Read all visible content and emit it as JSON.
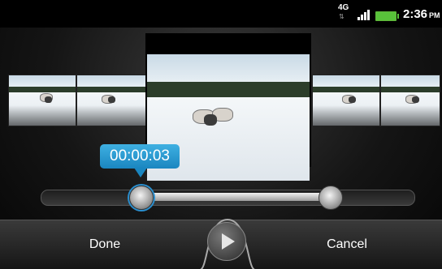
{
  "status_bar": {
    "network": "4G",
    "time": "2:36",
    "ampm": "PM",
    "battery_color": "#58c23a"
  },
  "trimmer": {
    "current_time": "00:00:03",
    "trim_start_fraction": 0.25,
    "trim_end_fraction": 0.77
  },
  "buttons": {
    "done": "Done",
    "cancel": "Cancel"
  },
  "colors": {
    "accent": "#2a8fcf"
  }
}
